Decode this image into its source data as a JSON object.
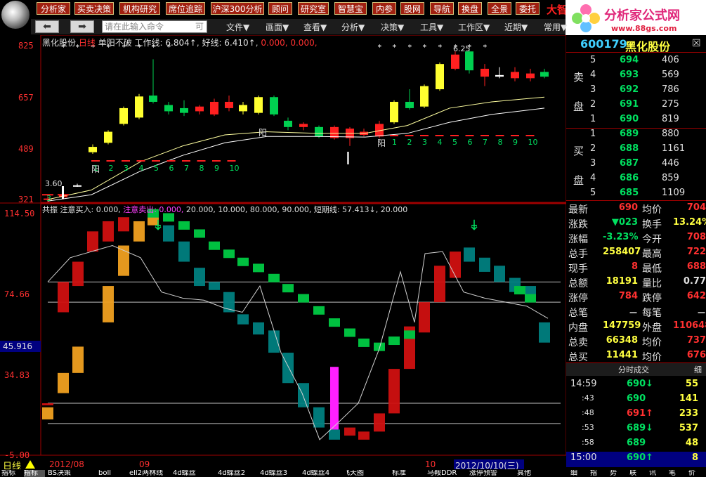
{
  "toolbar": {
    "buttons": [
      "分析家",
      "买卖决策",
      "机构研究",
      "席位追踪",
      "沪深300分析",
      "顾问",
      "研究室",
      "智慧宝",
      "内参",
      "股网",
      "导航",
      "换盘",
      "全景",
      "委托"
    ],
    "brand_mark": "大智",
    "brand_name": "分析家公式网",
    "brand_url": "www.88gs.com"
  },
  "menubar": {
    "back_glyph": "⬅",
    "forward_glyph": "➡",
    "command_placeholder": "请在此输入命令",
    "command_suffix": "可",
    "menus": [
      "文件▼",
      "画面▼",
      "查看▼",
      "分析▼",
      "决策▼",
      "工具▼",
      "工作区▼",
      "近期▼",
      "常用▼"
    ]
  },
  "main_chart": {
    "header_name": "黑化股份",
    "header_period": "日线",
    "header_title": "单阳不破",
    "header_work": "工作线: 6.804↑",
    "header_good": "好线: 6.410↑",
    "header_zeros": "0.000, 0.000,",
    "y_labels": [
      "825",
      "657",
      "489",
      "321"
    ],
    "star_marks": "* * * * *",
    "top_annotation": "6.25",
    "yang_label": "阳",
    "count_labels_a": [
      "1",
      "2",
      "3",
      "4",
      "5",
      "6",
      "7",
      "8",
      "9",
      "10"
    ],
    "count_labels_b": [
      "1",
      "2",
      "3",
      "4",
      "5",
      "6",
      "7",
      "8",
      "9",
      "10"
    ],
    "price_label": "3.60",
    "small_label_3": "3"
  },
  "lower_chart": {
    "header_name": "共振",
    "header_buy": "注意买入: 0.000,",
    "header_sell": "注意卖出: 0.000,",
    "header_rest": "20.000, 10.000, 80.000, 90.000,",
    "header_short": "短期线: 57.413↓, 20.000",
    "y_labels": [
      "114.50",
      "74.66",
      "45.916",
      "34.83",
      "-5.00"
    ],
    "cursor_value": "45.916"
  },
  "time_axis": {
    "period_label": "日线",
    "labels": [
      "2012/08",
      "09",
      "10"
    ],
    "cursor_date": "2012/10/10(三)"
  },
  "quote": {
    "code": "600179",
    "name": "黑化股份",
    "close_glyph": "☒",
    "sell_label_1": "卖",
    "sell_label_2": "盘",
    "buy_label_1": "买",
    "buy_label_2": "盘",
    "sells": [
      {
        "lvl": "5",
        "price": "694",
        "vol": "406"
      },
      {
        "lvl": "4",
        "price": "693",
        "vol": "569"
      },
      {
        "lvl": "3",
        "price": "692",
        "vol": "786"
      },
      {
        "lvl": "2",
        "price": "691",
        "vol": "275"
      },
      {
        "lvl": "1",
        "price": "690",
        "vol": "819"
      }
    ],
    "buys": [
      {
        "lvl": "1",
        "price": "689",
        "vol": "880"
      },
      {
        "lvl": "2",
        "price": "688",
        "vol": "1161"
      },
      {
        "lvl": "3",
        "price": "687",
        "vol": "446"
      },
      {
        "lvl": "4",
        "price": "686",
        "vol": "859"
      },
      {
        "lvl": "5",
        "price": "685",
        "vol": "1109"
      }
    ],
    "stats": [
      {
        "k1": "最新",
        "v1": "690",
        "k2": "均价",
        "v2": "704"
      },
      {
        "k1": "涨跌",
        "v1": "▼023",
        "k2": "换手",
        "v2": "13.24%"
      },
      {
        "k1": "涨幅",
        "v1": "-3.23%",
        "k2": "今开",
        "v2": "708"
      },
      {
        "k1": "总手",
        "v1": "258407",
        "k2": "最高",
        "v2": "722"
      },
      {
        "k1": "现手",
        "v1": "8",
        "k2": "最低",
        "v2": "688"
      },
      {
        "k1": "总额",
        "v1": "18191",
        "k2": "量比",
        "v2": "0.77"
      },
      {
        "k1": "涨停",
        "v1": "784",
        "k2": "跌停",
        "v2": "642"
      },
      {
        "k1": "总笔",
        "v1": "－",
        "k2": "每笔",
        "v2": "－"
      },
      {
        "k1": "内盘",
        "v1": "147759",
        "k2": "外盘",
        "v2": "110648"
      },
      {
        "k1": "总卖",
        "v1": "66348",
        "k2": "均价",
        "v2": "737"
      },
      {
        "k1": "总买",
        "v1": "11441",
        "k2": "均价",
        "v2": "676"
      }
    ],
    "ticks_tab": "分时成交",
    "ticks_tab2": "细",
    "ticks": [
      {
        "t": "14:59",
        "p": "690↓",
        "v": "55"
      },
      {
        "t": ":43",
        "p": "690",
        "v": "141"
      },
      {
        "t": ":48",
        "p": "691↑",
        "v": "233"
      },
      {
        "t": ":53",
        "p": "689↓",
        "v": "537"
      },
      {
        "t": ":58",
        "p": "689",
        "v": "48"
      },
      {
        "t": "15:00",
        "p": "690↑",
        "v": "8"
      }
    ]
  },
  "bottom_tabs": [
    "指标",
    "指标",
    "BS决策",
    "boll",
    "ell2两林线",
    "4d蝶丝",
    "4d蝶丝2",
    "4d蝶丝3",
    "4d蝶丝4",
    "飞天图",
    "标准",
    "马鞍DDR",
    "涨停预警",
    "其他"
  ],
  "bottom_right_tabs": [
    "细",
    "指",
    "势",
    "联",
    "讯",
    "笔",
    "价"
  ]
}
